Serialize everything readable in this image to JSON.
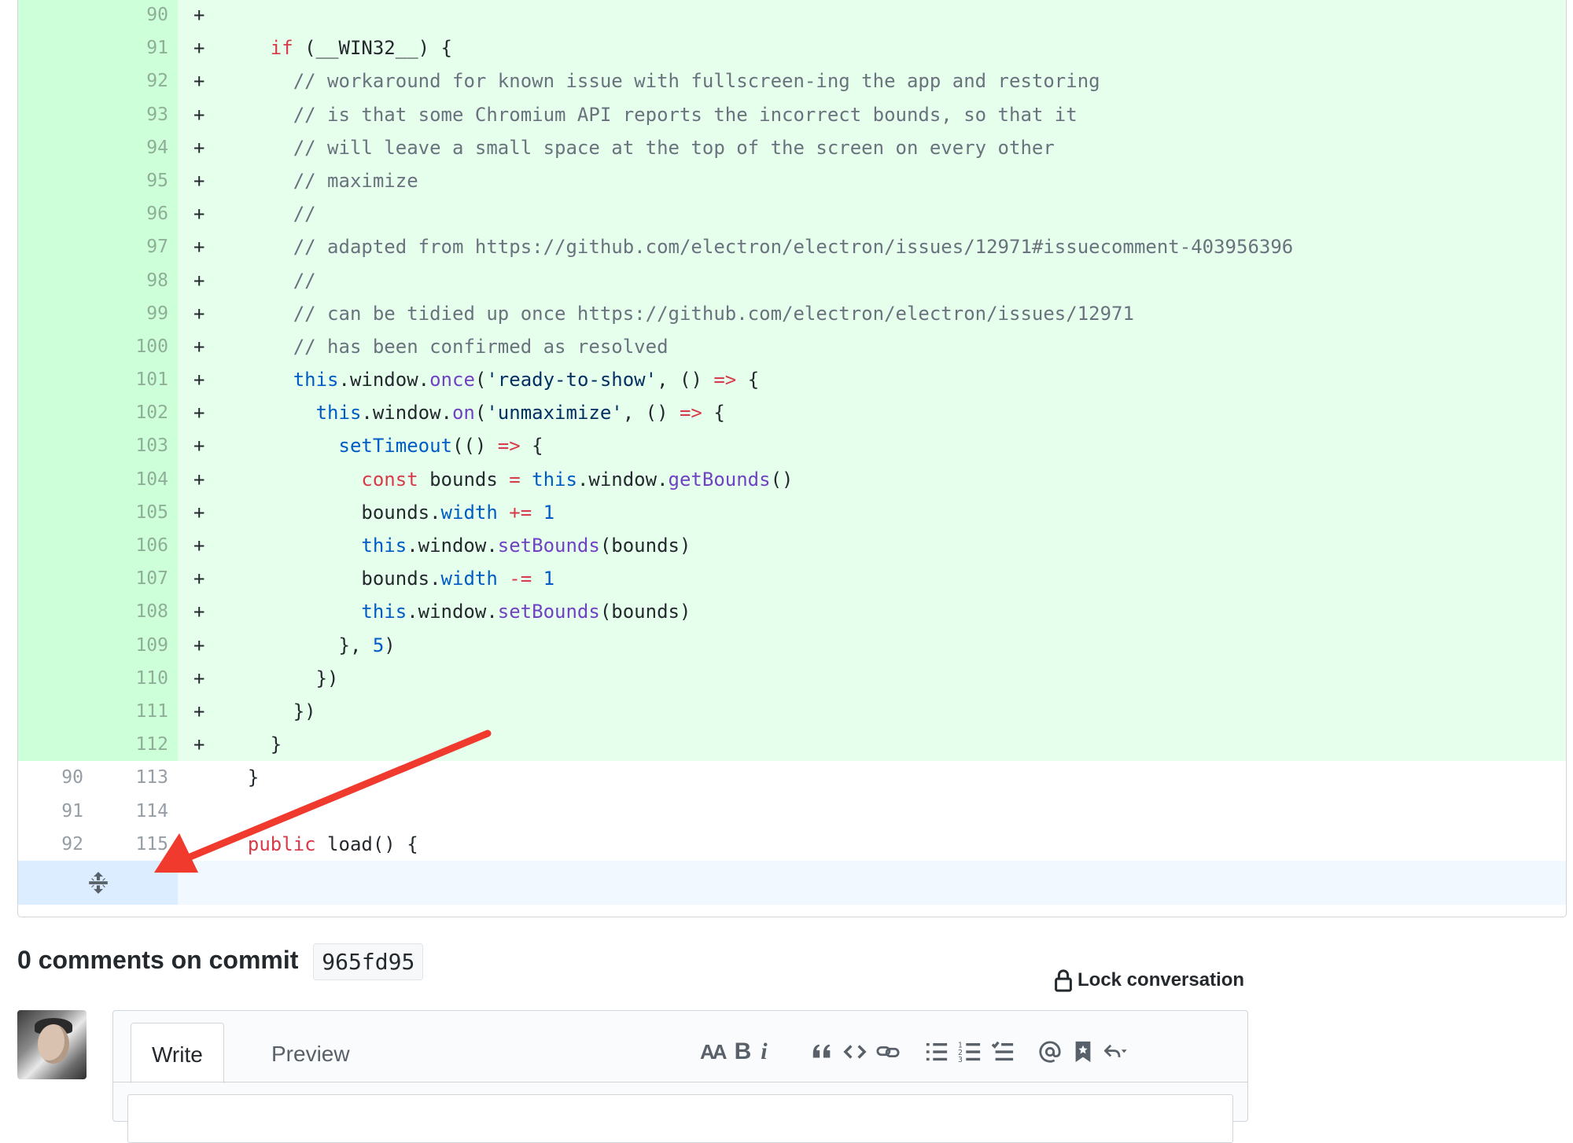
{
  "diff": {
    "rows": [
      {
        "type": "add",
        "old": "",
        "new": "90",
        "text": ""
      },
      {
        "type": "add",
        "old": "",
        "new": "91",
        "text": "if (__WIN32__) {"
      },
      {
        "type": "add",
        "old": "",
        "new": "92",
        "text": "// workaround for known issue with fullscreen-ing the app and restoring"
      },
      {
        "type": "add",
        "old": "",
        "new": "93",
        "text": "// is that some Chromium API reports the incorrect bounds, so that it"
      },
      {
        "type": "add",
        "old": "",
        "new": "94",
        "text": "// will leave a small space at the top of the screen on every other"
      },
      {
        "type": "add",
        "old": "",
        "new": "95",
        "text": "// maximize"
      },
      {
        "type": "add",
        "old": "",
        "new": "96",
        "text": "//"
      },
      {
        "type": "add",
        "old": "",
        "new": "97",
        "text": "// adapted from https://github.com/electron/electron/issues/12971#issuecomment-403956396"
      },
      {
        "type": "add",
        "old": "",
        "new": "98",
        "text": "//"
      },
      {
        "type": "add",
        "old": "",
        "new": "99",
        "text": "// can be tidied up once https://github.com/electron/electron/issues/12971"
      },
      {
        "type": "add",
        "old": "",
        "new": "100",
        "text": "// has been confirmed as resolved"
      },
      {
        "type": "add",
        "old": "",
        "new": "101",
        "text": "this.window.once('ready-to-show', () => {"
      },
      {
        "type": "add",
        "old": "",
        "new": "102",
        "text": "this.window.on('unmaximize', () => {"
      },
      {
        "type": "add",
        "old": "",
        "new": "103",
        "text": "setTimeout(() => {"
      },
      {
        "type": "add",
        "old": "",
        "new": "104",
        "text": "const bounds = this.window.getBounds()"
      },
      {
        "type": "add",
        "old": "",
        "new": "105",
        "text": "bounds.width += 1"
      },
      {
        "type": "add",
        "old": "",
        "new": "106",
        "text": "this.window.setBounds(bounds)"
      },
      {
        "type": "add",
        "old": "",
        "new": "107",
        "text": "bounds.width -= 1"
      },
      {
        "type": "add",
        "old": "",
        "new": "108",
        "text": "this.window.setBounds(bounds)"
      },
      {
        "type": "add",
        "old": "",
        "new": "109",
        "text": "}, 5)"
      },
      {
        "type": "add",
        "old": "",
        "new": "110",
        "text": "})"
      },
      {
        "type": "add",
        "old": "",
        "new": "111",
        "text": "})"
      },
      {
        "type": "add",
        "old": "",
        "new": "112",
        "text": "}"
      },
      {
        "type": "ctx",
        "old": "90",
        "new": "113",
        "text": "}"
      },
      {
        "type": "ctx",
        "old": "91",
        "new": "114",
        "text": ""
      },
      {
        "type": "ctx",
        "old": "92",
        "new": "115",
        "text": "public load() {"
      }
    ],
    "add_marker": "+",
    "expand_icon": "unfold-icon"
  },
  "comments": {
    "title": "0 comments on commit",
    "sha": "965fd95",
    "lock_label": "Lock conversation",
    "lock_icon": "lock-icon"
  },
  "editor": {
    "tab_write": "Write",
    "tab_preview": "Preview",
    "toolbar": {
      "header": "AA",
      "bold": "B",
      "italic": "i",
      "icons": [
        "text-size-icon",
        "bold-icon",
        "italic-icon",
        "quote-icon",
        "code-icon",
        "link-icon",
        "bulleted-list-icon",
        "numbered-list-icon",
        "task-list-icon",
        "mention-icon",
        "reference-icon",
        "reply-icon"
      ]
    }
  },
  "colors": {
    "add_bg": "#e6ffed",
    "add_gutter": "#cdffd8",
    "keyword": "#d73a49",
    "function": "#6f42c1",
    "constant": "#005cc5",
    "string": "#032f62",
    "comment": "#6a737d",
    "annotation_arrow": "#f03a2e"
  }
}
